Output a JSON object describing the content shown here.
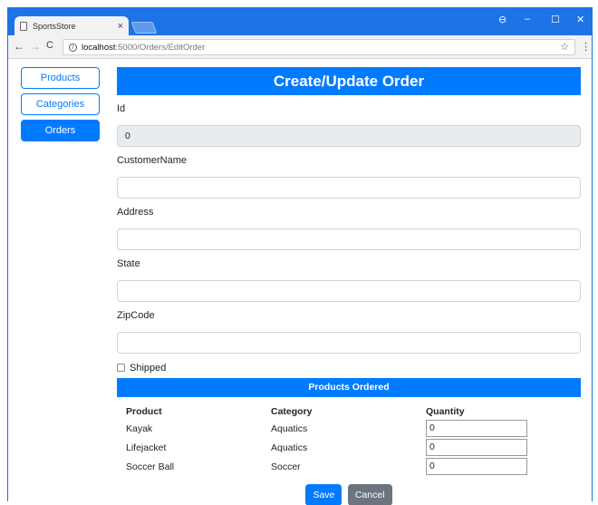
{
  "browser": {
    "tab_title": "SportsStore",
    "tab_close": "×",
    "url_host": "localhost",
    "url_path": ":5000/Orders/EditOrder",
    "controls": {
      "minimize": "–",
      "maximize": "☐",
      "close": "✕",
      "profile": "⊖"
    },
    "nav": {
      "back": "←",
      "forward": "→",
      "reload": "C"
    },
    "info_glyph": "i",
    "star_glyph": "☆",
    "menu_glyph": "⋮"
  },
  "sidebar": {
    "items": [
      {
        "label": "Products",
        "active": false
      },
      {
        "label": "Categories",
        "active": false
      },
      {
        "label": "Orders",
        "active": true
      }
    ]
  },
  "form": {
    "title": "Create/Update Order",
    "id_label": "Id",
    "id_value": "0",
    "customer_label": "CustomerName",
    "customer_value": "",
    "address_label": "Address",
    "address_value": "",
    "state_label": "State",
    "state_value": "",
    "zip_label": "ZipCode",
    "zip_value": "",
    "shipped_label": "Shipped",
    "shipped_checked": false
  },
  "products_ordered": {
    "title": "Products Ordered",
    "columns": [
      "Product",
      "Category",
      "Quantity"
    ],
    "rows": [
      {
        "product": "Kayak",
        "category": "Aquatics",
        "quantity": "0"
      },
      {
        "product": "Lifejacket",
        "category": "Aquatics",
        "quantity": "0"
      },
      {
        "product": "Soccer Ball",
        "category": "Soccer",
        "quantity": "0"
      }
    ]
  },
  "actions": {
    "save": "Save",
    "cancel": "Cancel"
  },
  "colors": {
    "primary": "#007bff",
    "secondary": "#6c757d",
    "titlebar": "#1e73e6"
  }
}
